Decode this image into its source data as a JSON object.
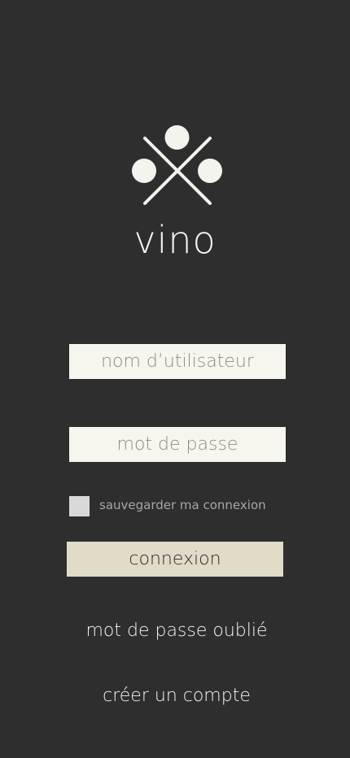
{
  "app": {
    "logo_icon": "crossed-sticks-with-three-dots-icon",
    "name": "vino"
  },
  "login_form": {
    "username": {
      "placeholder": "nom d’utilisateur",
      "value": ""
    },
    "password": {
      "placeholder": "mot de passe",
      "value": ""
    },
    "remember": {
      "label": "sauvegarder ma connexion",
      "checked": false
    },
    "submit_label": "connexion"
  },
  "links": {
    "forgot_password": "mot de passe oublié",
    "create_account": "créer un compte"
  },
  "colors": {
    "background": "#2e2e2e",
    "foreground": "#f4f4ee",
    "field_background": "#f6f6ee",
    "button_background": "#e1dcc8",
    "checkbox_background": "#d9d9d9"
  }
}
